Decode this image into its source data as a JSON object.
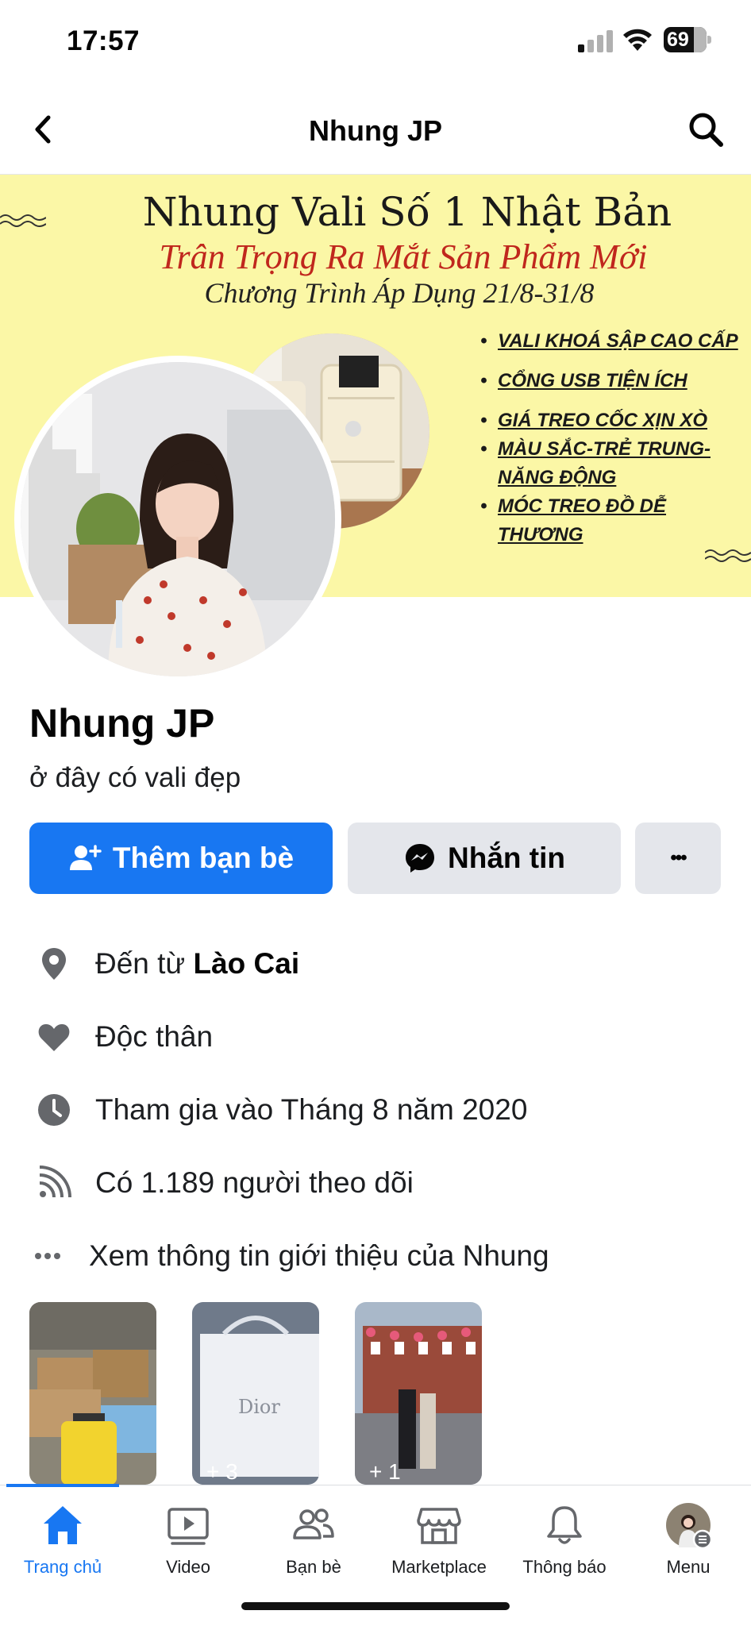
{
  "status_bar": {
    "time": "17:57",
    "battery": "69"
  },
  "header": {
    "title": "Nhung JP"
  },
  "cover": {
    "title": "Nhung Vali Số 1 Nhật Bản",
    "subtitle": "Trân Trọng Ra Mắt Sản Phẩm Mới",
    "program": "Chương Trình Áp Dụng 21/8-31/8",
    "features": [
      {
        "lines": [
          "VALI KHOÁ SẬP CAO CẤP"
        ]
      },
      {
        "lines": [
          "CỔNG USB TIỆN ÍCH"
        ]
      },
      {
        "lines": [
          "GIÁ TREO CỐC XỊN XÒ"
        ]
      },
      {
        "lines": [
          "MÀU SẮC-TRẺ TRUNG-",
          "NĂNG ĐỘNG"
        ]
      },
      {
        "lines": [
          "MÓC TREO ĐỒ DỄ",
          "THƯƠNG"
        ]
      }
    ]
  },
  "profile": {
    "name": "Nhung JP",
    "bio": "ở đây có vali đẹp"
  },
  "actions": {
    "add_friend": "Thêm bạn bè",
    "message": "Nhắn tin",
    "more": "•••"
  },
  "details": {
    "hometown_prefix": "Đến từ ",
    "hometown": "Lào Cai",
    "relationship": "Độc thân",
    "joined": "Tham gia vào Tháng 8 năm 2020",
    "followers": "Có 1.189 người theo dõi",
    "see_about": "Xem thông tin giới thiệu của Nhung"
  },
  "photos": [
    {
      "count": ""
    },
    {
      "count": "+ 3"
    },
    {
      "count": "+ 1"
    }
  ],
  "tabs": [
    {
      "label": "Trang chủ",
      "icon": "home-icon",
      "active": true
    },
    {
      "label": "Video",
      "icon": "video-icon"
    },
    {
      "label": "Bạn bè",
      "icon": "friends-icon"
    },
    {
      "label": "Marketplace",
      "icon": "marketplace-icon"
    },
    {
      "label": "Thông báo",
      "icon": "bell-icon"
    },
    {
      "label": "Menu",
      "icon": "menu-avatar-icon"
    }
  ],
  "colors": {
    "primary": "#1877f2",
    "button_gray": "#e4e6eb",
    "cover_bg": "#fbf7a6",
    "cover_red": "#c0271d"
  }
}
